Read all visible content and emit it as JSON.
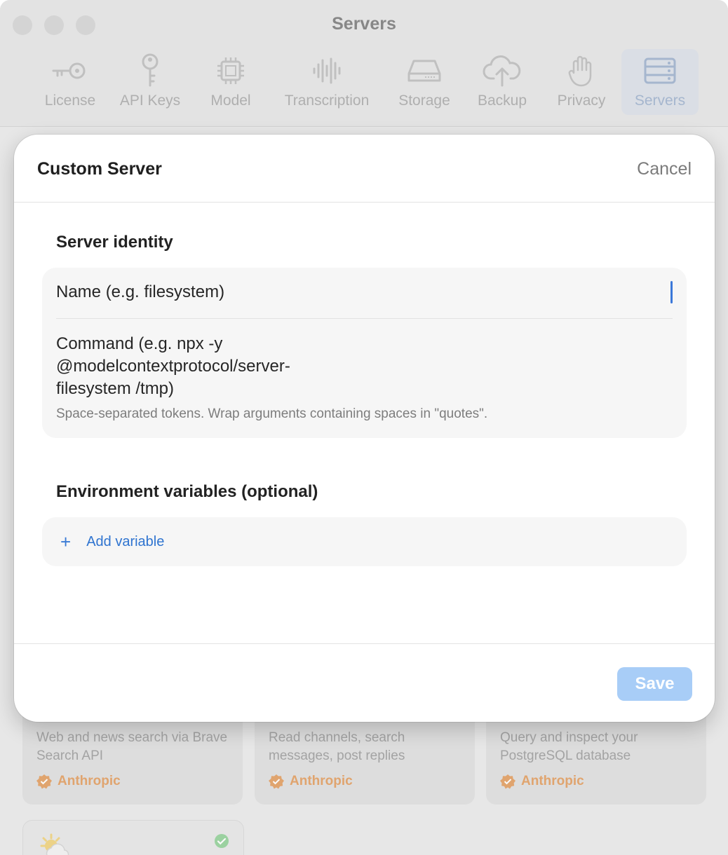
{
  "window": {
    "title": "Servers"
  },
  "toolbar": {
    "tabs": [
      {
        "label": "License",
        "icon": "key-icon"
      },
      {
        "label": "API Keys",
        "icon": "api-key-icon"
      },
      {
        "label": "Model",
        "icon": "chip-icon"
      },
      {
        "label": "Transcription",
        "icon": "waveform-icon"
      },
      {
        "label": "Storage",
        "icon": "drive-icon"
      },
      {
        "label": "Backup",
        "icon": "cloud-upload-icon"
      },
      {
        "label": "Privacy",
        "icon": "hand-icon"
      },
      {
        "label": "Servers",
        "icon": "server-rack-icon",
        "selected": true
      }
    ]
  },
  "background_cards": [
    {
      "description": "Web and news search via Brave Search API",
      "vendor": "Anthropic"
    },
    {
      "description": "Read channels, search messages, post replies",
      "vendor": "Anthropic"
    },
    {
      "description": "Query and inspect your PostgreSQL database",
      "vendor": "Anthropic"
    }
  ],
  "modal": {
    "title": "Custom Server",
    "cancel_label": "Cancel",
    "identity_section_label": "Server identity",
    "name_placeholder": "Name (e.g. filesystem)",
    "command_placeholder": "Command (e.g. npx -y @modelcontextprotocol/server-filesystem /tmp)",
    "command_hint": "Space-separated tokens. Wrap arguments containing spaces in \"quotes\".",
    "env_section_label": "Environment variables (optional)",
    "add_variable_label": "Add variable",
    "save_label": "Save"
  },
  "colors": {
    "accent": "#3a7bd5",
    "save_disabled": "#a8cdf7",
    "vendor_badge": "#e5a871"
  }
}
